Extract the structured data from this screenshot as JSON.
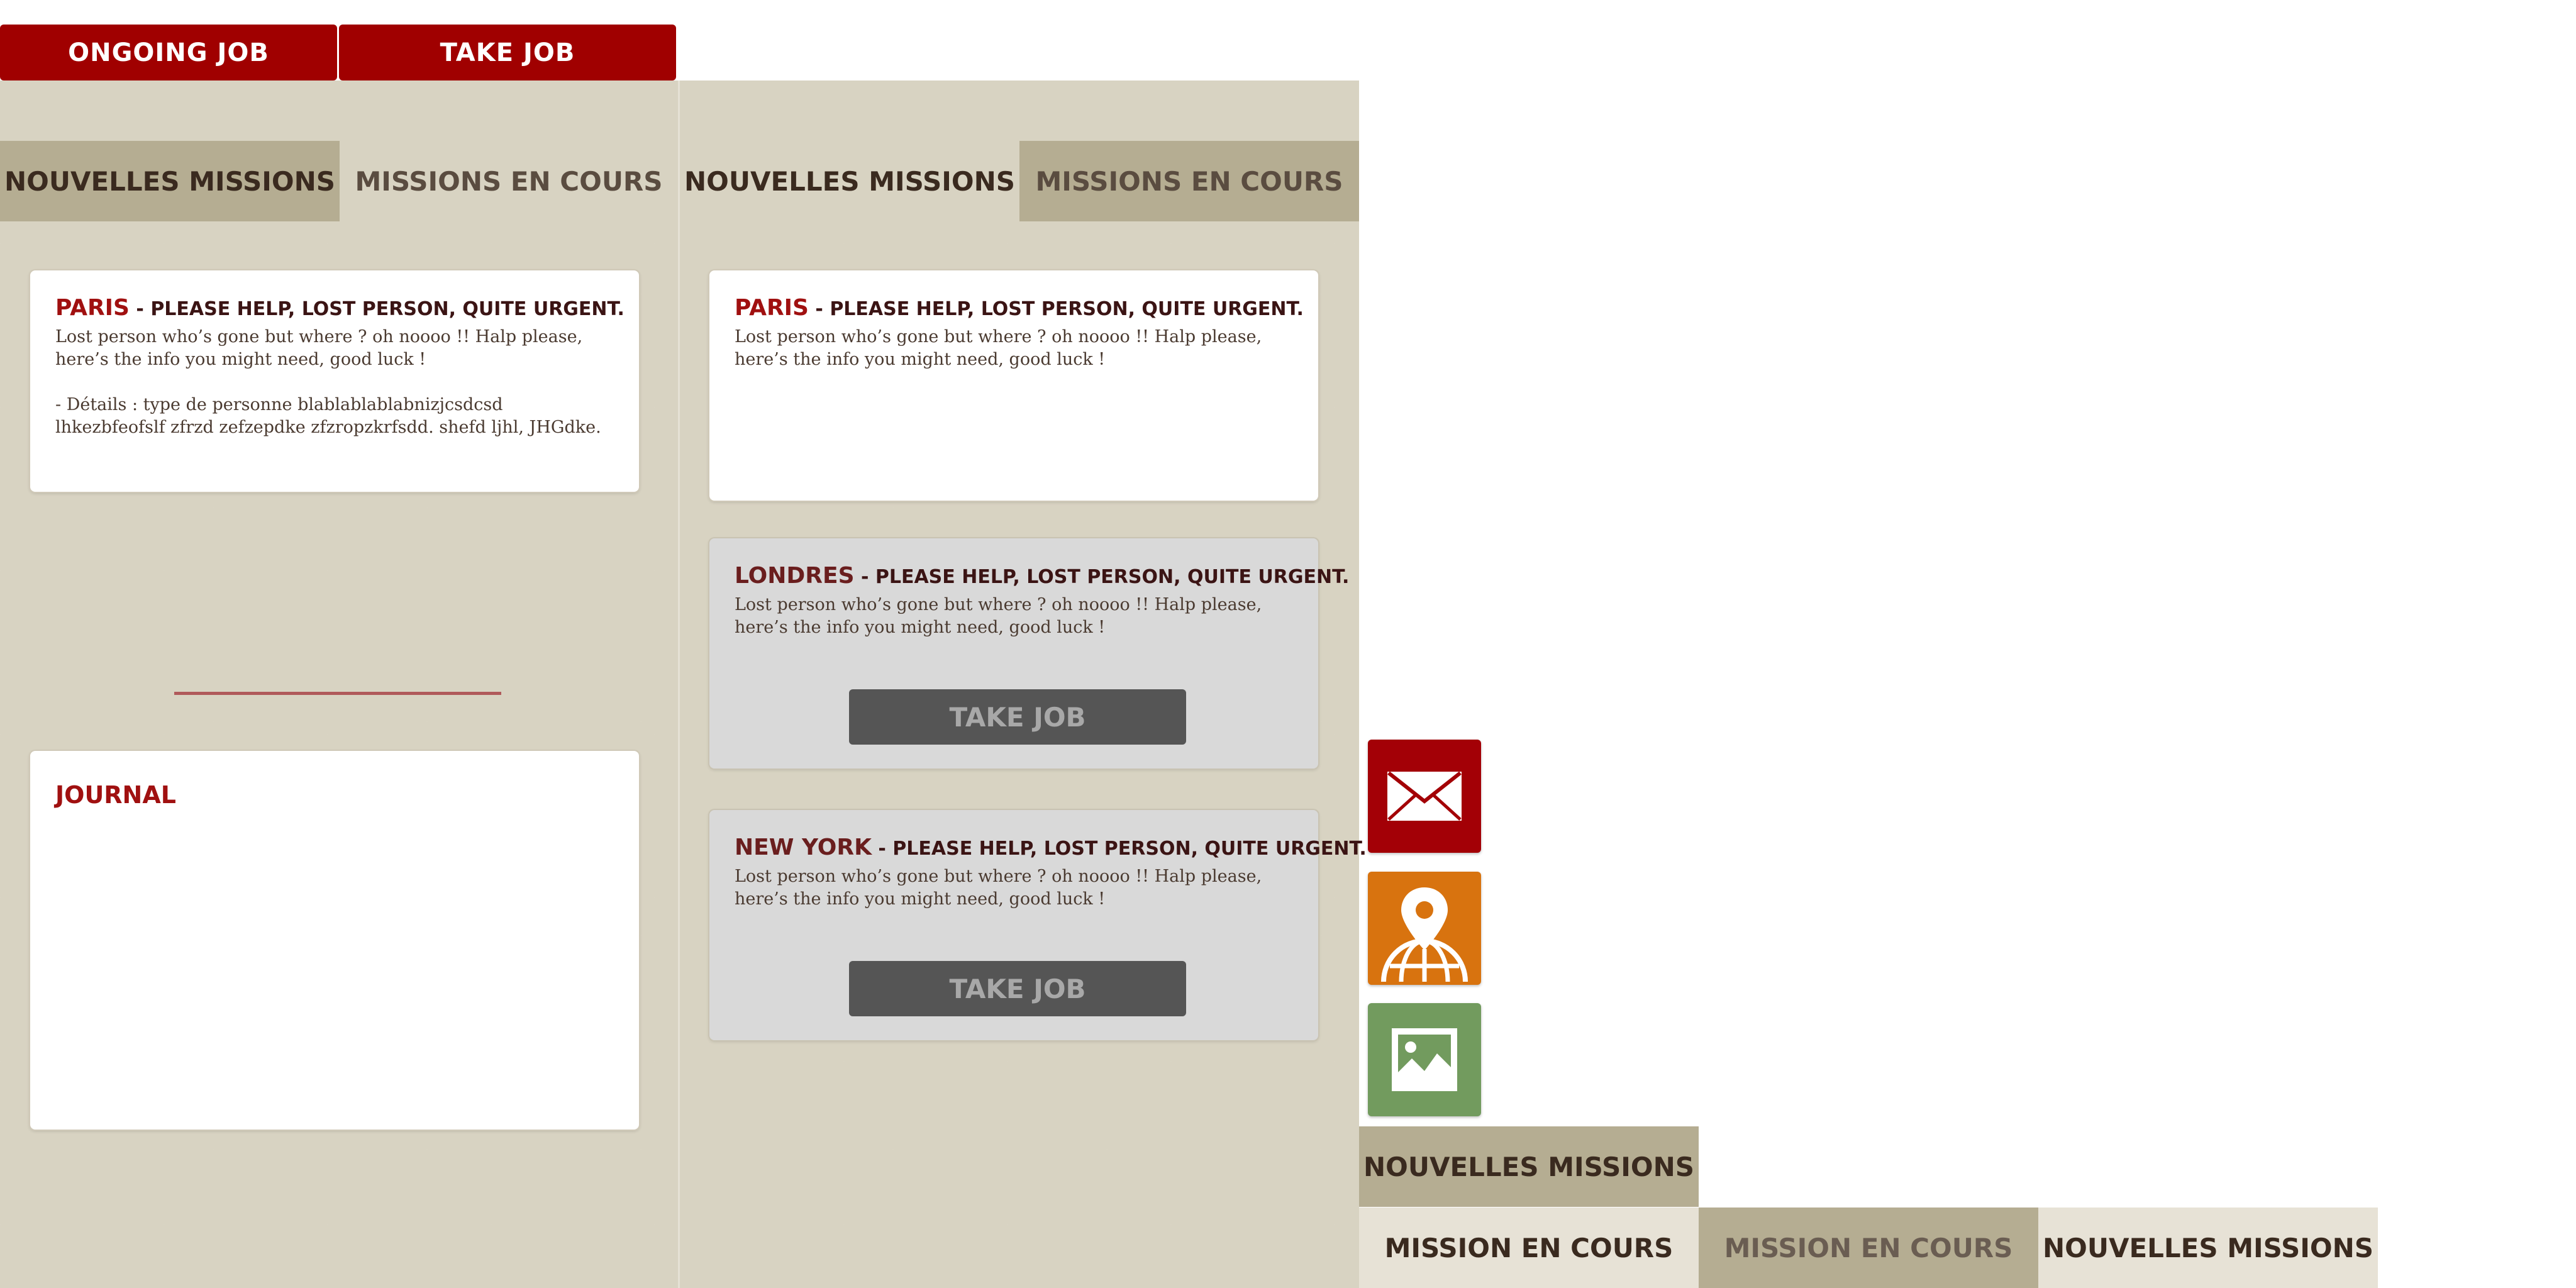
{
  "top_buttons": {
    "ongoing": "ONGOING JOB",
    "take": "TAKE JOB"
  },
  "panel_left": {
    "tabs": [
      "NOUVELLES MISSIONS",
      "MISSIONS EN COURS"
    ],
    "active_tab": 0,
    "card": {
      "city": "PARIS",
      "title": " - PLEASE HELP, LOST PERSON, QUITE URGENT.",
      "body": "Lost person who’s gone but where ? oh noooo !! Halp please, here’s the info you might need, good luck !",
      "details": "- Détails : type de personne blablablablabnizjcsdcsd lhkezbfeofslf zfrzd zefzepdke zfzropzkrfsdd. shefd ljhl, JHGdke."
    },
    "journal": {
      "title": "JOURNAL"
    }
  },
  "panel_right": {
    "tabs": [
      "NOUVELLES MISSIONS",
      "MISSIONS EN COURS"
    ],
    "active_tab": 1,
    "cards": [
      {
        "city": "PARIS",
        "title": " - PLEASE HELP, LOST PERSON, QUITE URGENT.",
        "body": "Lost person who’s gone but where ? oh noooo !! Halp please, here’s the info you might need, good luck !"
      },
      {
        "city": "LONDRES",
        "title": " - PLEASE HELP, LOST PERSON, QUITE URGENT.",
        "body": "Lost person who’s gone but where ? oh noooo !! Halp please, here’s the info you might need, good luck !",
        "button": "TAKE JOB"
      },
      {
        "city": "NEW YORK",
        "title": " - PLEASE HELP, LOST PERSON, QUITE URGENT.",
        "body": "Lost person who’s gone but where ? oh noooo !! Halp please, here’s the info you might need, good luck !",
        "button": "TAKE JOB"
      }
    ]
  },
  "icon_tiles": [
    {
      "icon": "mail-icon",
      "color": "#a30006"
    },
    {
      "icon": "location-globe-icon",
      "color": "#d8730f"
    },
    {
      "icon": "image-icon",
      "color": "#729b5e"
    }
  ],
  "bottom_tabs": {
    "nouvelles_single": "NOUVELLES MISSIONS",
    "row": [
      "MISSION EN COURS",
      "MISSION EN COURS",
      "NOUVELLES MISSIONS"
    ]
  },
  "colors": {
    "brand_red": "#a00000",
    "panel_bg": "#d8d3c2",
    "tab_active": "#b5ad92",
    "button_grey": "#555555"
  }
}
